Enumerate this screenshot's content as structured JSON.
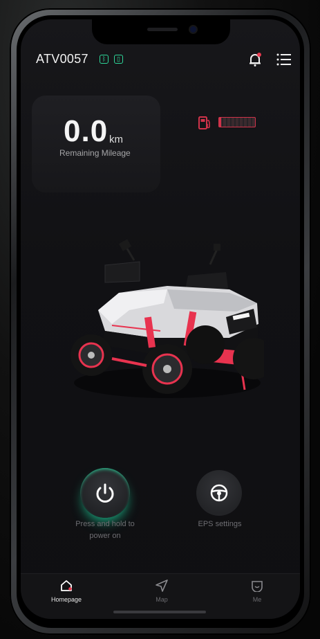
{
  "header": {
    "device_id": "ATV0057",
    "bluetooth_icon": "bluetooth-icon",
    "signal_icon": "sim-signal-icon",
    "notification_icon": "bell-icon",
    "menu_icon": "menu-list-icon"
  },
  "mileage": {
    "value": "0.0",
    "unit": "km",
    "label": "Remaining Mileage"
  },
  "fuel": {
    "icon": "fuel-pump-icon",
    "level": 0.05
  },
  "controls": {
    "power_label": "Press and hold to power on",
    "eps_label": "EPS settings"
  },
  "tabs": [
    {
      "label": "Homepage",
      "icon": "home-icon"
    },
    {
      "label": "Map",
      "icon": "navigation-arrow-icon"
    },
    {
      "label": "Me",
      "icon": "profile-face-icon"
    }
  ],
  "colors": {
    "accent_green": "#2ed89a",
    "accent_red": "#d0334a"
  }
}
